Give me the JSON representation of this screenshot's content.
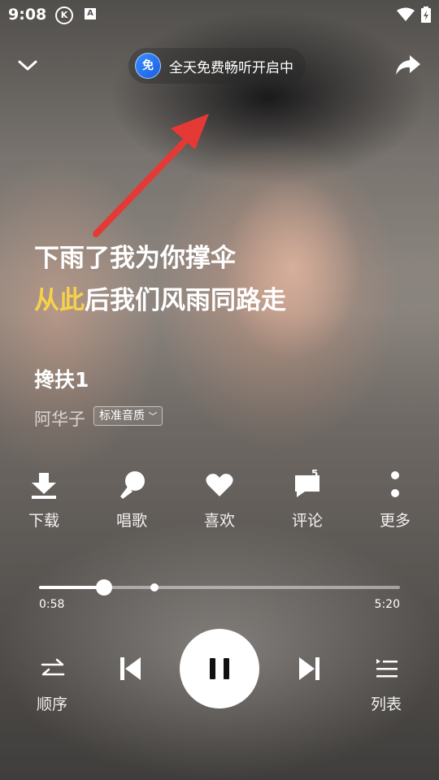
{
  "status_bar": {
    "time": "9:08",
    "k_badge": "K",
    "a_badge": "A"
  },
  "top": {
    "pill_badge": "免",
    "pill_text": "全天免费畅听开启中"
  },
  "lyrics": {
    "line1": "下雨了我为你撑伞",
    "line2_highlight": "从此",
    "line2_rest": "后我们风雨同路走"
  },
  "song": {
    "title": "搀扶1",
    "artist": "阿华子",
    "quality": "标准音质"
  },
  "actions": {
    "download": "下载",
    "sing": "唱歌",
    "like": "喜欢",
    "comment": "评论",
    "comment_count": "5",
    "more": "更多"
  },
  "progress": {
    "current": "0:58",
    "total": "5:20",
    "fraction": 0.18,
    "marker_fraction": 0.32
  },
  "controls": {
    "order": "顺序",
    "list": "列表"
  },
  "colors": {
    "highlight": "#f5d24a",
    "pill_badge": "#2a74f0",
    "arrow": "#e53935"
  }
}
